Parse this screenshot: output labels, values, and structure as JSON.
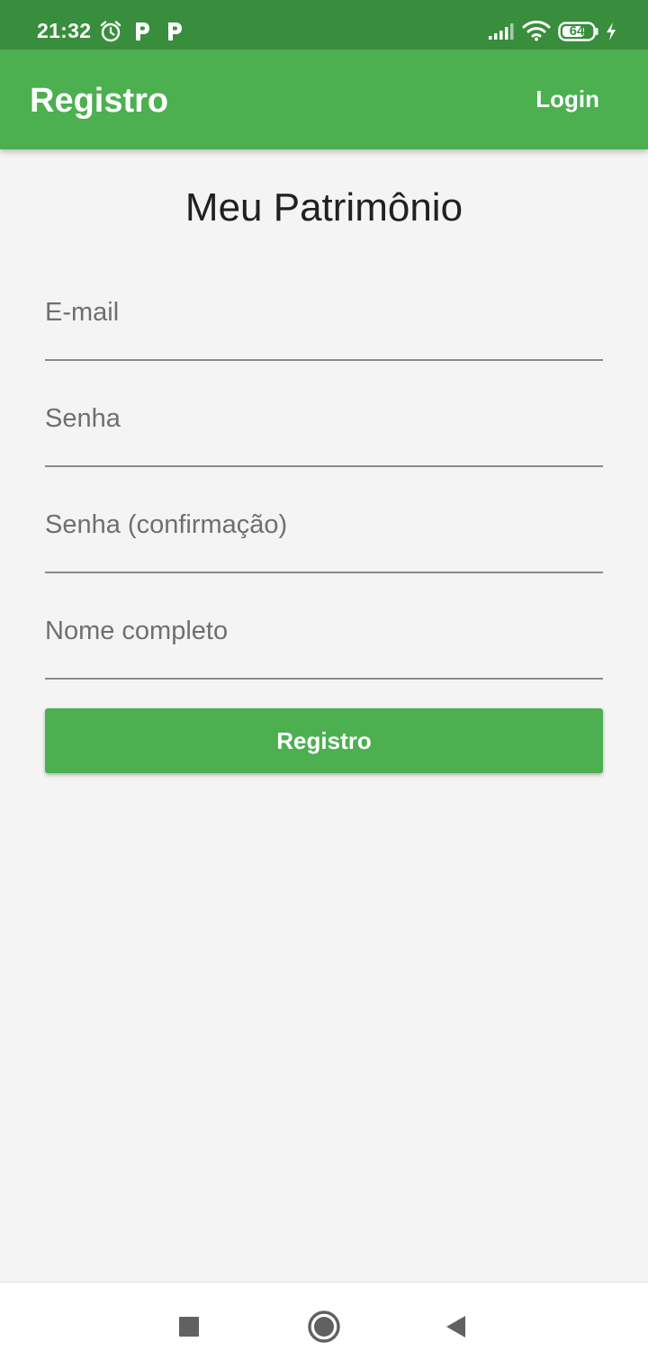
{
  "status_bar": {
    "time": "21:32",
    "battery_level": "64",
    "icons": [
      "alarm-icon",
      "p-notification-icon",
      "p-notification-icon",
      "signal-icon",
      "wifi-icon",
      "battery-icon",
      "charging-icon"
    ]
  },
  "app_bar": {
    "title": "Registro",
    "login_label": "Login"
  },
  "page": {
    "heading": "Meu Patrimônio"
  },
  "form": {
    "email_placeholder": "E-mail",
    "email_value": "",
    "password_placeholder": "Senha",
    "password_value": "",
    "password_confirm_placeholder": "Senha (confirmação)",
    "password_confirm_value": "",
    "full_name_placeholder": "Nome completo",
    "full_name_value": "",
    "submit_label": "Registro"
  },
  "nav_bar": {
    "icons": [
      "recents-square-icon",
      "home-circle-icon",
      "back-triangle-icon"
    ]
  },
  "colors": {
    "status_bar": "#388e3c",
    "primary": "#4caf50",
    "background": "#f4f4f4"
  }
}
